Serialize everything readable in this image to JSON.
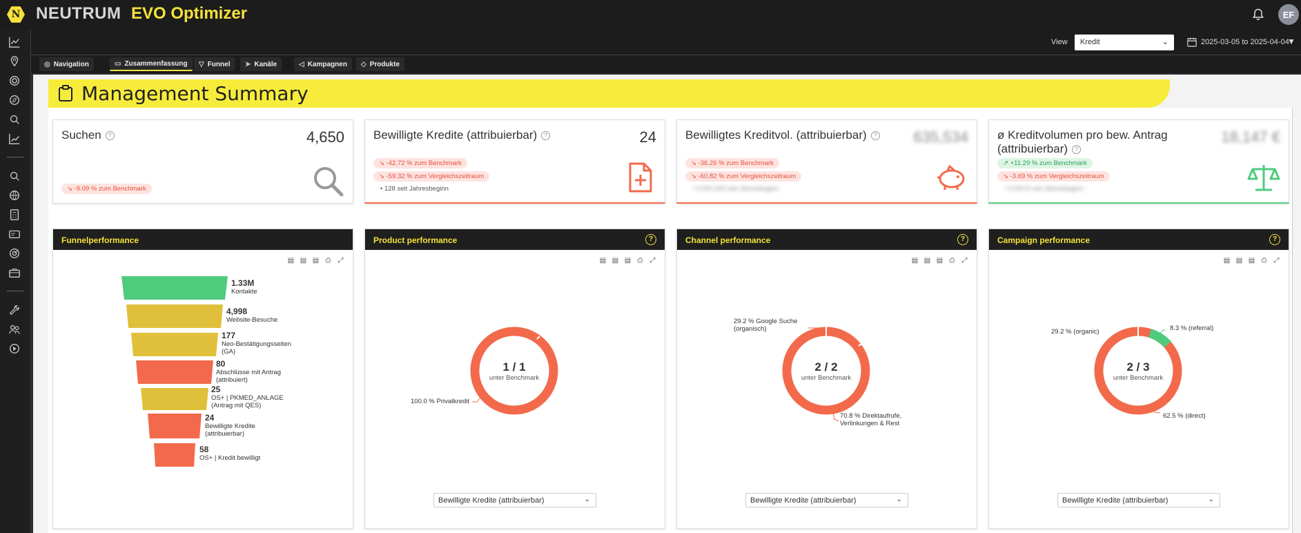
{
  "app": {
    "logo_letter": "N",
    "brand": "NEUTRUM",
    "product": "EVO Optimizer",
    "avatar": "EF"
  },
  "toolbar": {
    "view_label": "View",
    "view_value": "Kredit",
    "date_range": "2025-03-05 to 2025-04-04"
  },
  "tabs": [
    {
      "label": "Navigation",
      "icon": "compass-icon"
    },
    {
      "label": "Zusammenfassung",
      "icon": "clipboard-icon",
      "active": true
    },
    {
      "label": "Funnel",
      "icon": "filter-icon"
    },
    {
      "label": "Kanäle",
      "icon": "send-icon"
    },
    {
      "label": "Kampagnen",
      "icon": "megaphone-icon"
    },
    {
      "label": "Produkte",
      "icon": "tag-icon"
    }
  ],
  "page_title": "Management Summary",
  "kpis": [
    {
      "title": "Suchen",
      "value": "4,650",
      "badges": [
        {
          "text": "-9.09 % zum Benchmark",
          "tone": "red"
        }
      ],
      "note": "",
      "icon": "search-icon"
    },
    {
      "title": "Bewilligte Kredite (attribuierbar)",
      "value": "24",
      "badges": [
        {
          "text": "-42.72 % zum Benchmark",
          "tone": "red"
        },
        {
          "text": "-59.32 % zum Vergleichszeitraum",
          "tone": "red"
        }
      ],
      "note": "128 seit Jahresbeginn",
      "icon": "document-plus-icon"
    },
    {
      "title": "Bewilligtes Kreditvol. (attribuierbar)",
      "value": "635,534",
      "badges": [
        {
          "text": "-36.26 % zum Benchmark",
          "tone": "red"
        },
        {
          "text": "-60.82 % zum Vergleichszeitraum",
          "tone": "red"
        }
      ],
      "note": "0,000,000 seit Jahresbeginn",
      "icon": "piggy-bank-icon"
    },
    {
      "title": "ø Kreditvolumen pro bew. Antrag (attribuierbar)",
      "value": "18,147 €",
      "badges": [
        {
          "text": "+11.29 % zum Benchmark",
          "tone": "green"
        },
        {
          "text": "-3.69 % zum Vergleichszeitraum",
          "tone": "red"
        }
      ],
      "note": "0,000 € seit Jahresbeginn",
      "icon": "scale-icon"
    }
  ],
  "cards": {
    "funnel": {
      "title": "Funnelperformance",
      "steps": [
        {
          "value": "1.33M",
          "label": "Kontakte",
          "color": "#4ecb7d"
        },
        {
          "value": "4,998",
          "label": "Website-Besuche",
          "color": "#e0c03a"
        },
        {
          "value": "177",
          "label": "Neo-Bestätigungsseiten (GA)",
          "color": "#e0c03a"
        },
        {
          "value": "80",
          "label": "Abschlüsse mit Antrag (attribuiert)",
          "color": "#f26a4b"
        },
        {
          "value": "25",
          "label": "OS+ | PKMED_ANLAGE (Antrag mit QES)",
          "color": "#e0c03a"
        },
        {
          "value": "24",
          "label": "Bewilligte Kredite (attribuierbar)",
          "color": "#f26a4b"
        },
        {
          "value": "58",
          "label": "OS+ | Kredit bewilligt",
          "color": "#f26a4b"
        }
      ]
    },
    "product": {
      "title": "Product performance",
      "center_big": "1 / 1",
      "center_small": "unter Benchmark",
      "labels": [
        "100.0 % Privatkredit"
      ],
      "select": "Bewilligte Kredite (attribuierbar)"
    },
    "channel": {
      "title": "Channel performance",
      "center_big": "2 / 2",
      "center_small": "unter Benchmark",
      "labels": [
        "29.2 % Google Suche (organisch)",
        "70.8 % Direktaufrufe, Verlinkungen & Rest"
      ],
      "select": "Bewilligte Kredite (attribuierbar)"
    },
    "campaign": {
      "title": "Campaign performance",
      "center_big": "2 / 3",
      "center_small": "unter Benchmark",
      "labels": [
        "29.2 % (organic)",
        "8.3 % (referral)",
        "62.5 % (direct)"
      ],
      "select": "Bewilligte Kredite (attribuierbar)"
    }
  },
  "colors": {
    "accent": "#f5e23a",
    "negative": "#f26a4b",
    "positive": "#4ecb7d",
    "topbar": "#1c1c1c"
  }
}
